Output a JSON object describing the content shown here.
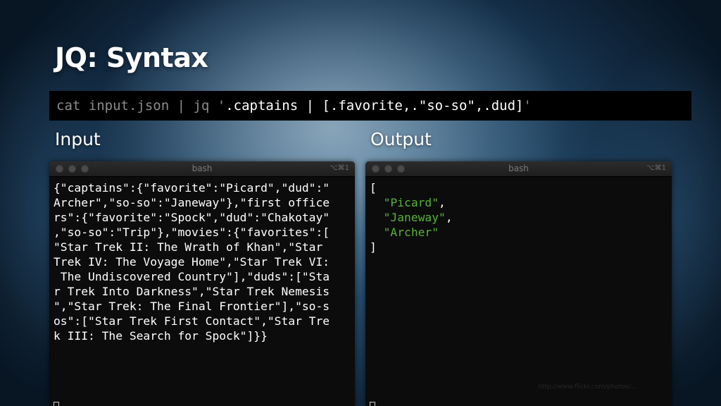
{
  "slide": {
    "title": "JQ: Syntax",
    "command": {
      "prefix": "cat input.json | jq '",
      "filter": ".captains | [.favorite,.\"so-so\",.dud]",
      "suffix": "'"
    },
    "input_label": "Input",
    "output_label": "Output"
  },
  "input_terminal": {
    "title": "bash",
    "shortcut": "⌥⌘1",
    "lines": [
      "{\"captains\":{\"favorite\":\"Picard\",\"dud\":\"",
      "Archer\",\"so-so\":\"Janeway\"},\"first office",
      "rs\":{\"favorite\":\"Spock\",\"dud\":\"Chakotay\"",
      ",\"so-so\":\"Trip\"},\"movies\":{\"favorites\":[",
      "\"Star Trek II: The Wrath of Khan\",\"Star",
      "Trek IV: The Voyage Home\",\"Star Trek VI:",
      " The Undiscovered Country\"],\"duds\":[\"Sta",
      "r Trek Into Darkness\",\"Star Trek Nemesis",
      "\",\"Star Trek: The Final Frontier\"],\"so-s",
      "os\":[\"Star Trek First Contact\",\"Star Tre",
      "k III: The Search for Spock\"]}}"
    ]
  },
  "output_terminal": {
    "title": "bash",
    "shortcut": "⌥⌘1",
    "open_bracket": "[",
    "values": [
      "\"Picard\"",
      "\"Janeway\"",
      "\"Archer\""
    ],
    "separator": ",",
    "close_bracket": "]",
    "watermark": "http://www.flickr.com/photos/..."
  },
  "colors": {
    "json_string_green": "#57b33a",
    "command_dim": "#8c8c8c"
  }
}
